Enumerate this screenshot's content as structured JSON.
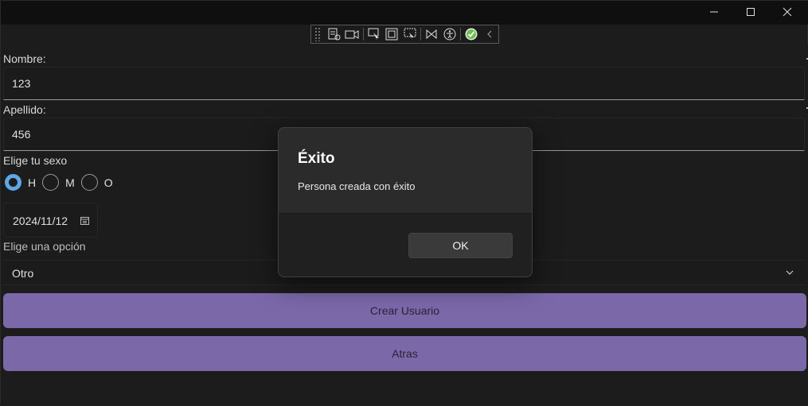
{
  "window": {
    "controls": {
      "minimize_icon": "minimize-icon",
      "maximize_icon": "maximize-icon",
      "close_icon": "close-icon"
    }
  },
  "devtools": {
    "icons": [
      "live-visual-tree-icon",
      "video-icon",
      "select-element-icon",
      "display-layout-adorners-icon",
      "track-focus-icon",
      "hot-reload-icon",
      "accessibility-icon",
      "hot-reload-ok-icon",
      "collapse-chevron-icon"
    ]
  },
  "form": {
    "nombre_label": "Nombre:",
    "nombre_value": "123",
    "apellido_label": "Apellido:",
    "apellido_value": "456",
    "sexo_label": "Elige tu sexo",
    "sexo_options": [
      {
        "label": "H",
        "checked": true
      },
      {
        "label": "M",
        "checked": false
      },
      {
        "label": "O",
        "checked": false
      }
    ],
    "date_value": "2024/11/12",
    "opcion_label": "Elige una opción",
    "opcion_value": "Otro",
    "crear_button": "Crear Usuario",
    "atras_button": "Atras"
  },
  "dialog": {
    "title": "Éxito",
    "message": "Persona creada con éxito",
    "ok_button": "OK"
  },
  "colors": {
    "accent_radio": "#5ea7e6",
    "button_purple": "#7a68a9",
    "dialog_bg": "#2b2b2b",
    "check_green": "#6cc04a"
  }
}
